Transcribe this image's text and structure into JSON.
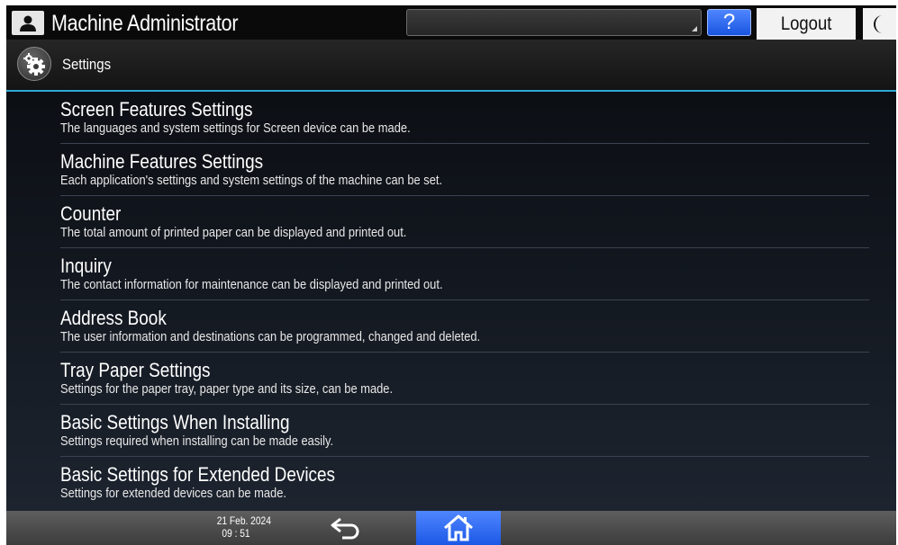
{
  "topbar": {
    "user_title": "Machine Administrator",
    "help_label": "?",
    "logout_label": "Logout"
  },
  "header": {
    "title": "Settings"
  },
  "menu": {
    "items": [
      {
        "title": "Screen Features Settings",
        "description": "The languages and system settings for Screen device can be made."
      },
      {
        "title": "Machine Features Settings",
        "description": "Each application's settings and system settings of the machine can be set."
      },
      {
        "title": "Counter",
        "description": "The total amount of printed paper can be displayed and printed out."
      },
      {
        "title": "Inquiry",
        "description": "The contact information for maintenance can be displayed and printed out."
      },
      {
        "title": "Address Book",
        "description": "The user information and destinations can be programmed, changed and deleted."
      },
      {
        "title": "Tray Paper Settings",
        "description": "Settings for the paper tray, paper type and its size, can be made."
      },
      {
        "title": "Basic Settings When Installing",
        "description": "Settings required when installing can be made easily."
      },
      {
        "title": "Basic Settings for Extended Devices",
        "description": "Settings for extended devices can be made."
      }
    ]
  },
  "bottombar": {
    "date": "21 Feb. 2024",
    "time": "09 : 51"
  },
  "icons": {
    "user": "user-icon",
    "settings": "gear-icon",
    "moon": "moon-icon",
    "back": "back-arrow-icon",
    "home": "home-icon"
  },
  "colors": {
    "accent": "#2ea7d8",
    "button_blue": "#2a63ee"
  }
}
